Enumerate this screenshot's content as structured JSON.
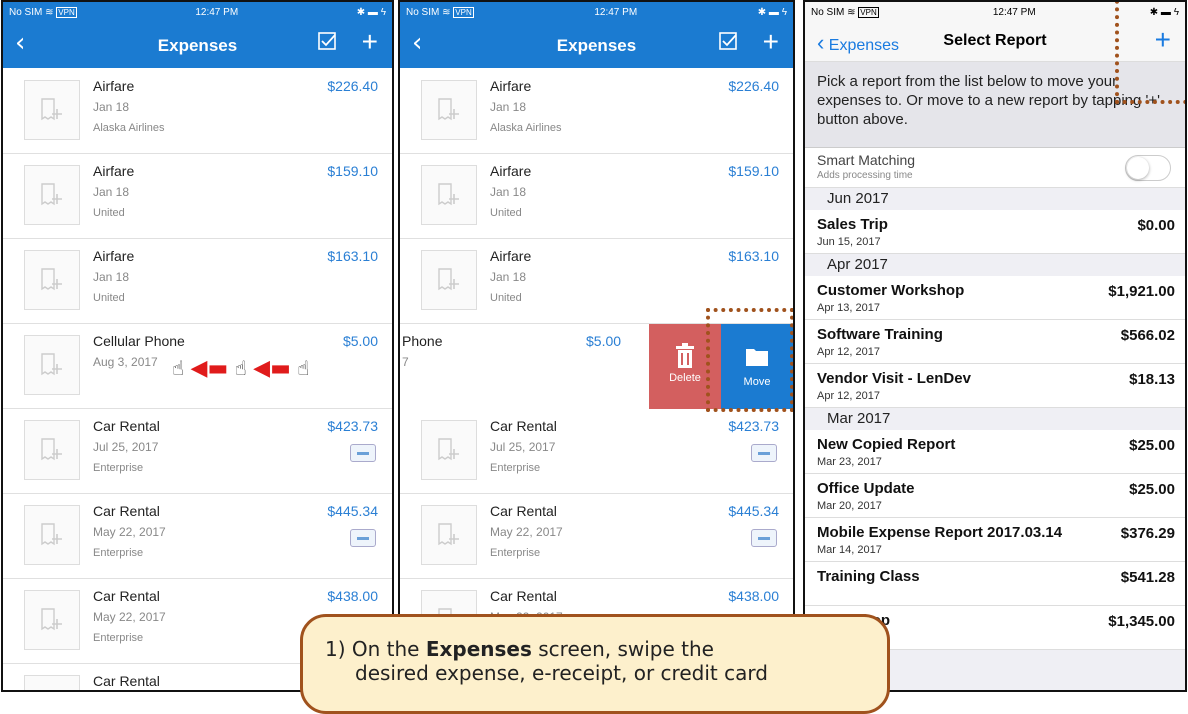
{
  "status": {
    "carrier": "No SIM",
    "vpn": "VPN",
    "time": "12:47 PM"
  },
  "expenses_screen": {
    "title": "Expenses",
    "rows": [
      {
        "title": "Airfare",
        "date": "Jan 18",
        "sub": "Alaska Airlines",
        "amount": "$226.40"
      },
      {
        "title": "Airfare",
        "date": "Jan 18",
        "sub": "United",
        "amount": "$159.10"
      },
      {
        "title": "Airfare",
        "date": "Jan 18",
        "sub": "United",
        "amount": "$163.10"
      },
      {
        "title": "Cellular Phone",
        "date": "Aug 3, 2017",
        "sub": "",
        "amount": "$5.00"
      },
      {
        "title": "Car Rental",
        "date": "Jul 25, 2017",
        "sub": "Enterprise",
        "amount": "$423.73"
      },
      {
        "title": "Car Rental",
        "date": "May 22, 2017",
        "sub": "Enterprise",
        "amount": "$445.34"
      },
      {
        "title": "Car Rental",
        "date": "May 22, 2017",
        "sub": "Enterprise",
        "amount": "$438.00"
      },
      {
        "title": "Car Rental",
        "date": "",
        "sub": "",
        "amount": ""
      }
    ]
  },
  "swipe": {
    "title_partial": "Phone",
    "date_partial": "7",
    "amount": "$5.00",
    "delete_label": "Delete",
    "move_label": "Move"
  },
  "select_report": {
    "back_label": "Expenses",
    "title": "Select Report",
    "instructions": "Pick a report from the list below to move your expenses to. Or move to a new report by tapping '+' button above.",
    "smart_matching": {
      "label": "Smart Matching",
      "sub": "Adds processing time"
    },
    "groups": [
      {
        "month": "Jun 2017",
        "reports": [
          {
            "name": "Sales Trip",
            "date": "Jun 15, 2017",
            "amount": "$0.00"
          }
        ]
      },
      {
        "month": "Apr 2017",
        "reports": [
          {
            "name": "Customer Workshop",
            "date": "Apr 13, 2017",
            "amount": "$1,921.00"
          },
          {
            "name": "Software Training",
            "date": "Apr 12, 2017",
            "amount": "$566.02"
          },
          {
            "name": "Vendor Visit - LenDev",
            "date": "Apr 12, 2017",
            "amount": "$18.13"
          }
        ]
      },
      {
        "month": "Mar 2017",
        "reports": [
          {
            "name": "New Copied Report",
            "date": "Mar 23, 2017",
            "amount": "$25.00"
          },
          {
            "name": "Office Update",
            "date": "Mar 20, 2017",
            "amount": "$25.00"
          },
          {
            "name": "Mobile Expense Report 2017.03.14",
            "date": "Mar 14, 2017",
            "amount": "$376.29"
          },
          {
            "name": "Training Class",
            "date": "",
            "amount": "$541.28"
          },
          {
            "name": "Workshop",
            "date": "",
            "amount": "$1,345.00"
          }
        ]
      }
    ]
  },
  "callout": {
    "prefix": "1) On the ",
    "bold": "Expenses",
    "line1_rest": " screen, swipe the",
    "line2": "desired expense, e-receipt, or credit card"
  },
  "colors": {
    "header_blue": "#1b7bd1",
    "link_blue": "#1a7be0",
    "delete_red": "#d35f5f",
    "annotation_brown": "#a0521d",
    "callout_fill": "#fdf0cc"
  }
}
